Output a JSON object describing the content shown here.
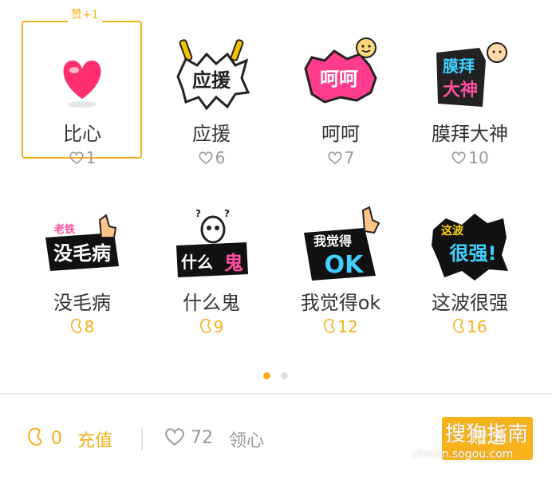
{
  "gift_panel": {
    "selected_badge": "赞+1",
    "items": [
      {
        "name": "比心",
        "currency": "heart",
        "price": "1",
        "icon": "heart-sticker"
      },
      {
        "name": "应援",
        "currency": "heart",
        "price": "6",
        "icon": "cheer-sticker",
        "art_text": "应援"
      },
      {
        "name": "呵呵",
        "currency": "heart",
        "price": "7",
        "icon": "hehe-sticker",
        "art_text": "呵呵"
      },
      {
        "name": "膜拜大神",
        "currency": "heart",
        "price": "10",
        "icon": "worship-sticker",
        "art_text": [
          "膜拜",
          "大神"
        ]
      },
      {
        "name": "没毛病",
        "currency": "bean",
        "price": "8",
        "icon": "no-problem-sticker",
        "art_text": [
          "老铁",
          "没毛病"
        ]
      },
      {
        "name": "什么鬼",
        "currency": "bean",
        "price": "9",
        "icon": "what-ghost-sticker",
        "art_text": [
          "什么",
          "鬼"
        ]
      },
      {
        "name": "我觉得ok",
        "currency": "bean",
        "price": "12",
        "icon": "ok-sticker",
        "art_text": [
          "我觉得",
          "OK"
        ]
      },
      {
        "name": "这波很强",
        "currency": "bean",
        "price": "16",
        "icon": "strong-sticker",
        "art_text": [
          "这波",
          "很强!"
        ]
      }
    ],
    "pagination": {
      "current": 1,
      "total": 2
    }
  },
  "footer": {
    "bean_balance": "0",
    "recharge_label": "充值",
    "heart_balance": "72",
    "claim_label": "领心",
    "send_label": "赠送"
  },
  "watermark": {
    "text": "搜狗指南",
    "url": "zhinan.sogou.com"
  },
  "colors": {
    "accent": "#f5b01b",
    "muted": "#999999",
    "text": "#333333"
  }
}
